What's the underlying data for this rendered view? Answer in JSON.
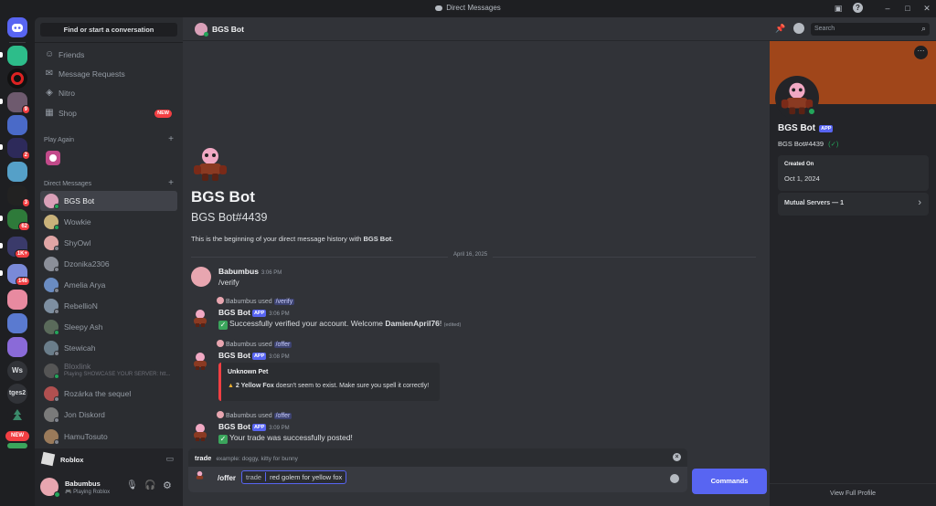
{
  "window": {
    "title": "Direct Messages"
  },
  "rail": {
    "badges": [
      "9",
      "2",
      "3",
      "62",
      "1K+",
      "146"
    ],
    "text_servers": [
      "Ws",
      "tges2"
    ],
    "new_label": "NEW"
  },
  "sidebar": {
    "search_label": "Find or start a conversation",
    "nav": [
      {
        "label": "Friends",
        "icon": "friends-icon"
      },
      {
        "label": "Message Requests",
        "icon": "mail-icon"
      },
      {
        "label": "Nitro",
        "icon": "nitro-icon"
      },
      {
        "label": "Shop",
        "icon": "shop-icon",
        "badge": "NEW"
      }
    ],
    "play_again_label": "Play Again",
    "dm_header": "Direct Messages",
    "dms": [
      {
        "name": "BGS Bot",
        "status": "online",
        "color": "#d9a0b8"
      },
      {
        "name": "Wowkie",
        "status": "online",
        "color": "#c9b27a"
      },
      {
        "name": "ShyOwl",
        "status": "offline",
        "color": "#e0a5a5"
      },
      {
        "name": "Dzonika2306",
        "status": "offline",
        "color": "#8b8f99"
      },
      {
        "name": "Amelia Arya",
        "status": "offline",
        "color": "#6a8cc2"
      },
      {
        "name": "RebellioN",
        "status": "offline",
        "color": "#7e8fa1"
      },
      {
        "name": "Sleepy Ash",
        "status": "online",
        "color": "#5a6a5a"
      },
      {
        "name": "Stewicah",
        "status": "offline",
        "color": "#6a7d8a"
      },
      {
        "name": "Bloxlink",
        "sub": "Playing SHOWCASE YOUR SERVER: htt...",
        "status": "online",
        "color": "#555"
      },
      {
        "name": "Rozárka the sequel",
        "status": "offline",
        "color": "#b05050"
      },
      {
        "name": "Jon Diskord",
        "status": "offline",
        "color": "#7a7a7a"
      },
      {
        "name": "HamuTosuto",
        "status": "offline",
        "color": "#9a7a5a"
      }
    ],
    "activity": {
      "name": "Roblox"
    },
    "user": {
      "name": "Babumbus",
      "status": "Playing Roblox"
    }
  },
  "chat": {
    "header_name": "BGS Bot",
    "intro_name": "BGS Bot",
    "intro_tag": "BGS Bot#4439",
    "intro_text_prefix": "This is the beginning of your direct message history with ",
    "intro_text_bold": "BGS Bot",
    "intro_text_suffix": ".",
    "date_divider": "April 16, 2025",
    "messages": [
      {
        "author": "Babumbus",
        "time": "3:06 PM",
        "text": "/verify"
      },
      {
        "reply_user": "Babumbus",
        "reply_used": "used",
        "reply_cmd": "/verify",
        "author": "BGS Bot",
        "app": "APP",
        "time": "3:06 PM",
        "text_prefix": "Successfully verified your account. Welcome ",
        "text_bold": "DamienApril76",
        "text_suffix": "!",
        "edited": "(edited)"
      },
      {
        "reply_user": "Babumbus",
        "reply_used": "used",
        "reply_cmd": "/offer",
        "author": "BGS Bot",
        "app": "APP",
        "time": "3:08 PM",
        "embed_title": "Unknown Pet",
        "embed_bold": "2 Yellow Fox",
        "embed_text": " doesn't seem to exist. Make sure you spell it correctly!"
      },
      {
        "reply_user": "Babumbus",
        "reply_used": "used",
        "reply_cmd": "/offer",
        "author": "BGS Bot",
        "app": "APP",
        "time": "3:09 PM",
        "text": "Your trade was successfully posted!"
      }
    ],
    "option_hint": {
      "name": "trade",
      "example": "example: doggy, kitty for bunny"
    },
    "composer": {
      "command": "/offer",
      "option": "trade",
      "value": "red golem for yellow fox"
    },
    "commands_button": "Commands"
  },
  "profile": {
    "search_placeholder": "Search",
    "banner_color": "#a0461a",
    "name": "BGS Bot",
    "app": "APP",
    "tag": "BGS Bot#4439",
    "created_label": "Created On",
    "created_date": "Oct 1, 2024",
    "mutual_label": "Mutual Servers — 1",
    "view_full": "View Full Profile"
  }
}
